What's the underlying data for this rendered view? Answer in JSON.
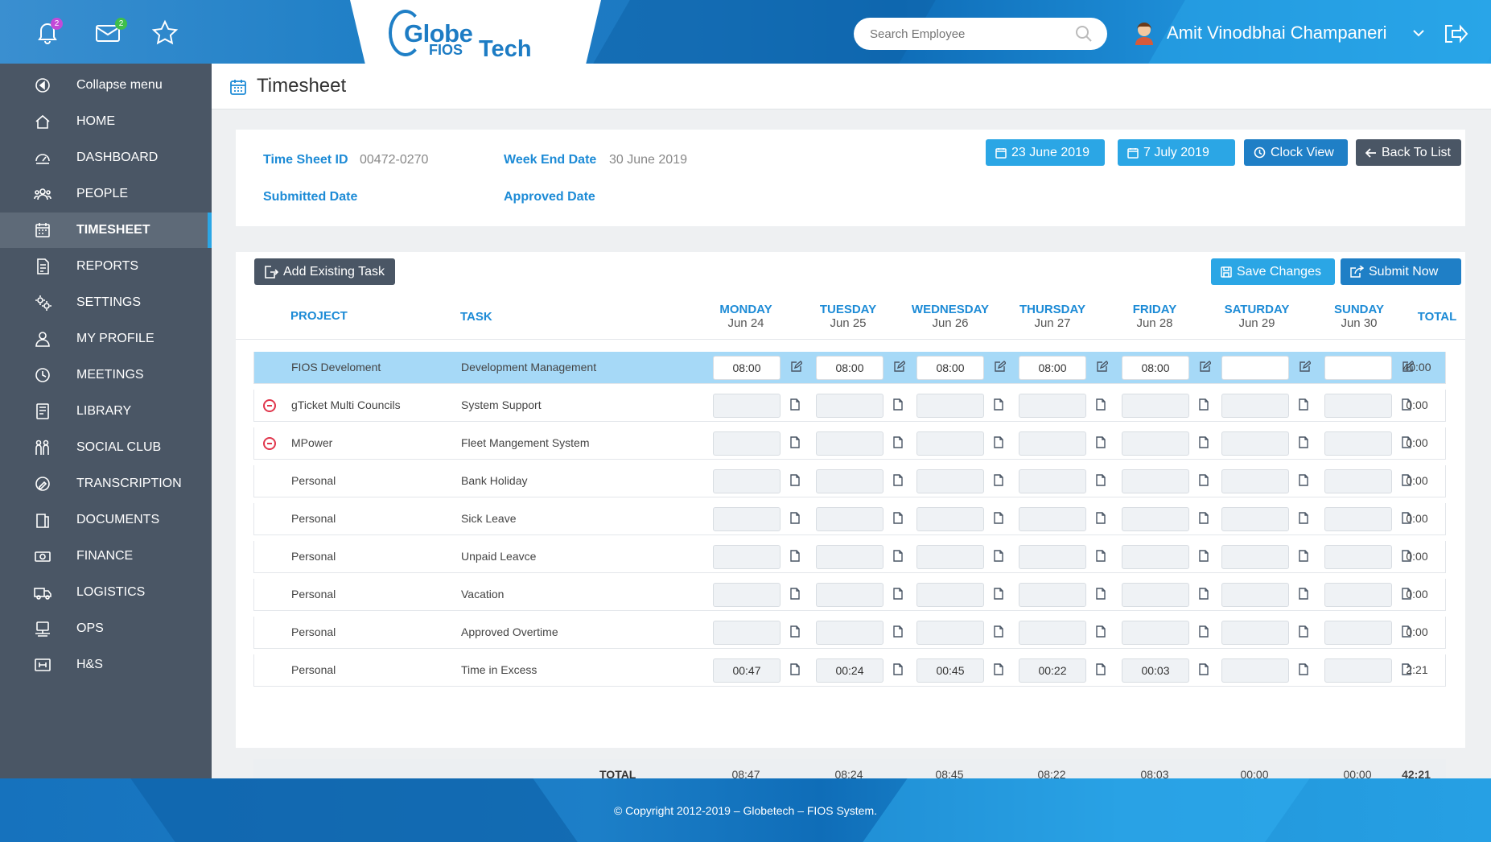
{
  "header": {
    "notifications_count": "2",
    "messages_count": "2",
    "logo": {
      "line1": "Globe",
      "line2": "FIOS",
      "line3": "Tech"
    },
    "search_placeholder": "Search Employee",
    "user_name": "Amit Vinodbhai Champaneri"
  },
  "sidebar": {
    "items": [
      {
        "label": "Collapse menu",
        "icon": "collapse-icon",
        "active": false
      },
      {
        "label": "HOME",
        "icon": "home-icon",
        "active": false
      },
      {
        "label": "DASHBOARD",
        "icon": "dashboard-icon",
        "active": false
      },
      {
        "label": "PEOPLE",
        "icon": "people-icon",
        "active": false
      },
      {
        "label": "TIMESHEET",
        "icon": "calendar-icon",
        "active": true
      },
      {
        "label": "REPORTS",
        "icon": "report-icon",
        "active": false
      },
      {
        "label": "SETTINGS",
        "icon": "settings-icon",
        "active": false
      },
      {
        "label": "MY PROFILE",
        "icon": "user-icon",
        "active": false
      },
      {
        "label": "MEETINGS",
        "icon": "clock-icon",
        "active": false
      },
      {
        "label": "LIBRARY",
        "icon": "book-icon",
        "active": false
      },
      {
        "label": "SOCIAL CLUB",
        "icon": "social-icon",
        "active": false
      },
      {
        "label": "TRANSCRIPTION",
        "icon": "transcription-icon",
        "active": false
      },
      {
        "label": "DOCUMENTS",
        "icon": "documents-icon",
        "active": false
      },
      {
        "label": "FINANCE",
        "icon": "finance-icon",
        "active": false
      },
      {
        "label": "LOGISTICS",
        "icon": "truck-icon",
        "active": false
      },
      {
        "label": "OPS",
        "icon": "ops-icon",
        "active": false
      },
      {
        "label": "H&S",
        "icon": "hs-icon",
        "active": false
      }
    ]
  },
  "page": {
    "title": "Timesheet"
  },
  "info": {
    "timesheet_id_label": "Time Sheet ID",
    "timesheet_id": "00472-0270",
    "week_end_label": "Week End Date",
    "week_end": "30 June 2019",
    "submitted_label": "Submitted Date",
    "approved_label": "Approved Date",
    "btn_prev": "23 June 2019",
    "btn_next": "7 July 2019",
    "btn_clock": "Clock View",
    "btn_back": "Back To List"
  },
  "toolbar": {
    "add_task": "Add Existing Task",
    "save": "Save Changes",
    "submit": "Submit Now"
  },
  "table": {
    "col_project": "PROJECT",
    "col_task": "TASK",
    "col_total": "TOTAL",
    "days": [
      {
        "name": "MONDAY",
        "date": "Jun 24"
      },
      {
        "name": "TUESDAY",
        "date": "Jun 25"
      },
      {
        "name": "WEDNESDAY",
        "date": "Jun 26"
      },
      {
        "name": "THURSDAY",
        "date": "Jun 27"
      },
      {
        "name": "FRIDAY",
        "date": "Jun 28"
      },
      {
        "name": "SATURDAY",
        "date": "Jun 29"
      },
      {
        "name": "SUNDAY",
        "date": "Jun 30"
      }
    ],
    "rows": [
      {
        "project": "FIOS Develoment",
        "task": "Development Management",
        "values": [
          "08:00",
          "08:00",
          "08:00",
          "08:00",
          "08:00",
          "",
          ""
        ],
        "total": "40:00",
        "highlight": true,
        "removable": false
      },
      {
        "project": "gTicket Multi Councils",
        "task": "System Support",
        "values": [
          "",
          "",
          "",
          "",
          "",
          "",
          ""
        ],
        "total": "0:00",
        "highlight": false,
        "removable": true
      },
      {
        "project": "MPower",
        "task": "Fleet Mangement System",
        "values": [
          "",
          "",
          "",
          "",
          "",
          "",
          ""
        ],
        "total": "0:00",
        "highlight": false,
        "removable": true
      },
      {
        "project": "Personal",
        "task": "Bank Holiday",
        "values": [
          "",
          "",
          "",
          "",
          "",
          "",
          ""
        ],
        "total": "0:00",
        "highlight": false,
        "removable": false
      },
      {
        "project": "Personal",
        "task": "Sick Leave",
        "values": [
          "",
          "",
          "",
          "",
          "",
          "",
          ""
        ],
        "total": "0:00",
        "highlight": false,
        "removable": false
      },
      {
        "project": "Personal",
        "task": "Unpaid Leavce",
        "values": [
          "",
          "",
          "",
          "",
          "",
          "",
          ""
        ],
        "total": "0:00",
        "highlight": false,
        "removable": false
      },
      {
        "project": "Personal",
        "task": "Vacation",
        "values": [
          "",
          "",
          "",
          "",
          "",
          "",
          ""
        ],
        "total": "0:00",
        "highlight": false,
        "removable": false
      },
      {
        "project": "Personal",
        "task": "Approved Overtime",
        "values": [
          "",
          "",
          "",
          "",
          "",
          "",
          ""
        ],
        "total": "0:00",
        "highlight": false,
        "removable": false
      },
      {
        "project": "Personal",
        "task": "Time in Excess",
        "values": [
          "00:47",
          "00:24",
          "00:45",
          "00:22",
          "00:03",
          "",
          ""
        ],
        "total": "2:21",
        "highlight": false,
        "removable": false
      }
    ],
    "totals": {
      "label": "TOTAL",
      "values": [
        "08:47",
        "08:24",
        "08:45",
        "08:22",
        "08:03",
        "00:00",
        "00:00"
      ],
      "grand": "42:21"
    }
  },
  "footer": {
    "text": "© Copyright 2012-2019 – Globetech – FIOS System."
  },
  "colors": {
    "accent": "#1d8bd6",
    "sidebar": "#4a5665",
    "highlight_row": "#a6d9f7",
    "btn_light": "#2ba6e5",
    "btn_dark": "#4a5665",
    "btn_blue": "#1f7fc6"
  }
}
